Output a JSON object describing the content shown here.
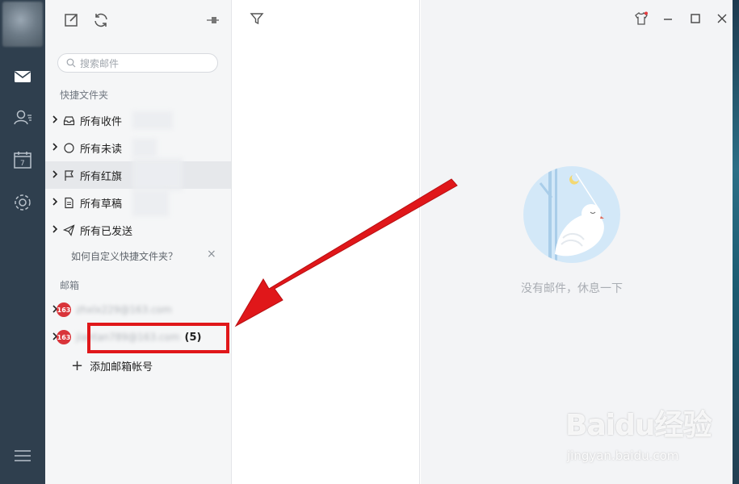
{
  "folders_panel": {
    "search": {
      "placeholder": "搜索邮件"
    },
    "quick_folders_title": "快捷文件夹",
    "quick_folders": [
      {
        "label": "所有收件",
        "icon": "inbox-icon"
      },
      {
        "label": "所有未读",
        "icon": "circle-icon"
      },
      {
        "label": "所有红旗",
        "icon": "flag-icon",
        "selected": true
      },
      {
        "label": "所有草稿",
        "icon": "draft-icon"
      },
      {
        "label": "所有已发送",
        "icon": "send-icon"
      }
    ],
    "help_text": "如何自定义快捷文件夹？",
    "help_close": "×",
    "mailbox_title": "邮箱",
    "accounts": [
      {
        "badge": "163",
        "address": "zhxlx229@163.com",
        "count": ""
      },
      {
        "badge": "163",
        "address": "jiantan789@163.com",
        "count": "(5)"
      }
    ],
    "add_account": "添加邮箱帐号"
  },
  "content": {
    "empty_text": "没有邮件，休息一下"
  },
  "watermark": {
    "text": "Baidu经验",
    "sub": "jingyan.baidu.com"
  },
  "colors": {
    "rail": "#2f3f4e",
    "highlight": "#e0171a",
    "badge": "#d9343a"
  }
}
